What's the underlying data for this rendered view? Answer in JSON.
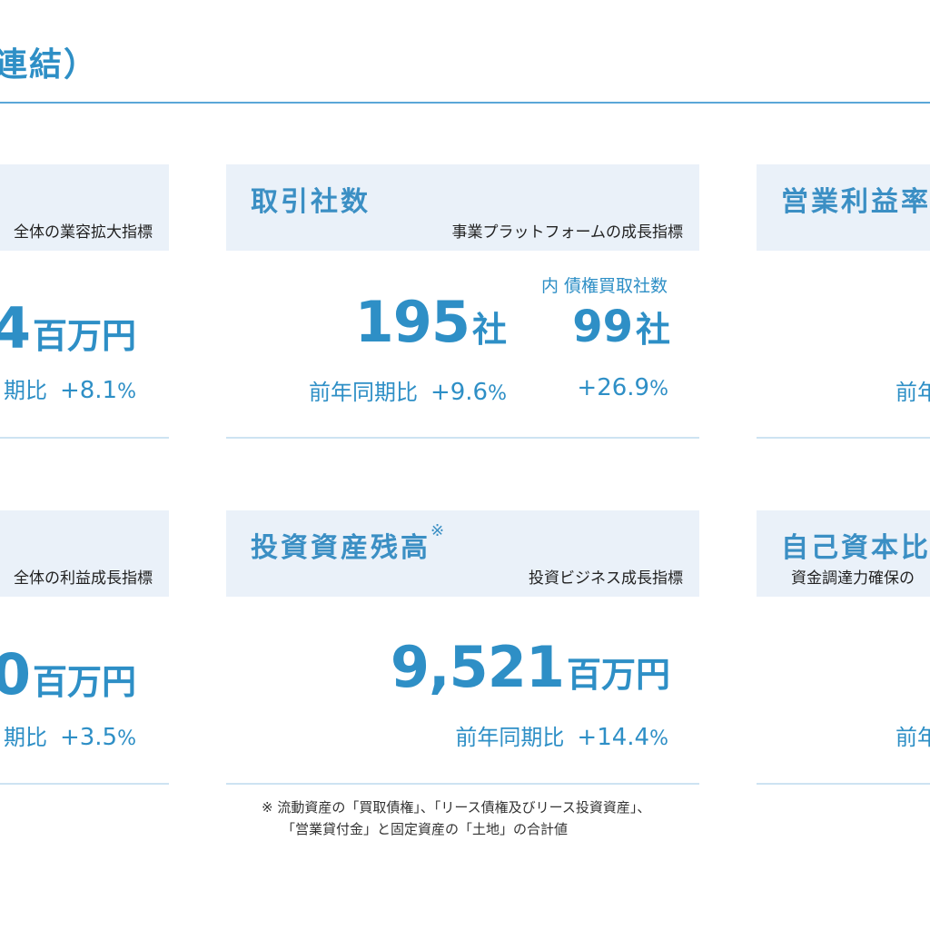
{
  "page": {
    "title_fragment": "連結）"
  },
  "cards": {
    "sales": {
      "subtitle_fragment": "全体の業容拡大指標",
      "value_fragment": "4",
      "unit": "百万円",
      "comparison_fragment": "期比",
      "change": "+8.1",
      "pct": "%"
    },
    "partners": {
      "title": "取引社数",
      "subtitle": "事業プラットフォームの成長指標",
      "value": "195",
      "unit": "社",
      "comparison_label": "前年同期比",
      "change": "+9.6",
      "pct": "%",
      "inner_label": "内 債権買取社数",
      "inner_value": "99",
      "inner_unit": "社",
      "inner_change": "+26.9",
      "inner_pct": "%"
    },
    "margin": {
      "title_fragment": "営業利益率",
      "comparison_fragment": "前年"
    },
    "profit": {
      "subtitle_fragment": "全体の利益成長指標",
      "value_fragment": "0",
      "unit": "百万円",
      "comparison_fragment": "期比",
      "change": "+3.5",
      "pct": "%"
    },
    "investment": {
      "title": "投資資産残高",
      "title_mark": "※",
      "subtitle": "投資ビジネス成長指標",
      "value": "9,521",
      "unit": "百万円",
      "comparison_label": "前年同期比",
      "change": "+14.4",
      "pct": "%"
    },
    "equity": {
      "title_fragment": "自己資本比",
      "subtitle_fragment": "資金調達力確保の",
      "comparison_fragment": "前年"
    }
  },
  "footnote": {
    "line1": "※ 流動資産の「買取債権」、「リース債権及びリース投資資産」、",
    "line2": "「営業貸付金」と固定資産の「土地」の合計値"
  }
}
